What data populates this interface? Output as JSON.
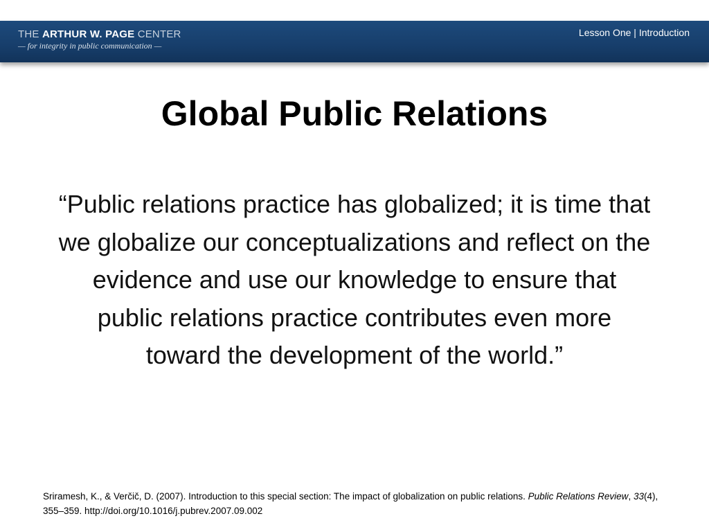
{
  "header": {
    "logo_the": "THE ",
    "logo_name": "ARTHUR W. PAGE",
    "logo_center": " CENTER",
    "logo_tagline": "— for integrity in public communication —",
    "lesson_label": "Lesson One | Introduction"
  },
  "slide": {
    "title": "Global Public Relations",
    "quote": "“Public relations practice has globalized; it is time that we globalize our conceptualizations and reflect on the evidence and use our knowledge to ensure that public relations practice contributes even more toward the development of the world.”"
  },
  "citation": {
    "authors": "Sriramesh, K., & Verčič, D. (2007). Introduction to this special section: The impact of globalization on public relations. ",
    "journal": "Public Relations Review",
    "sep1": ", ",
    "volume": "33",
    "rest": "(4), 355–359. http://doi.org/10.1016/j.pubrev.2007.09.002"
  }
}
